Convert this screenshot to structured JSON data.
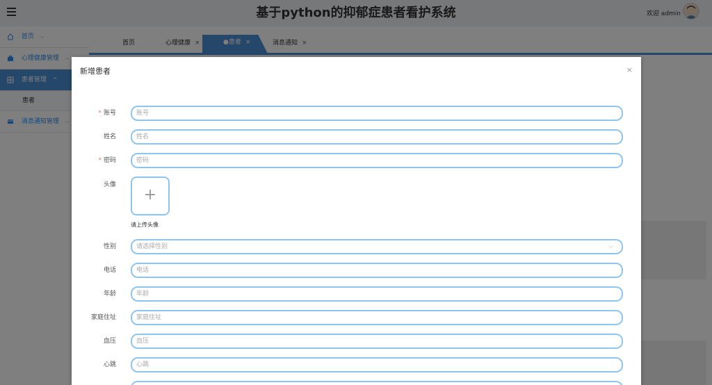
{
  "header": {
    "title": "基于python的抑郁症患者看护系统",
    "welcome": "欢迎 admin"
  },
  "sidebar": {
    "items": [
      {
        "label": "首页",
        "icon": "home-icon"
      },
      {
        "label": "心理健康管理",
        "icon": "briefcase-icon"
      },
      {
        "label": "患者管理",
        "icon": "grid-icon",
        "active": true
      },
      {
        "label": "消息通知管理",
        "icon": "card-icon"
      }
    ],
    "sub_items": [
      {
        "label": "患者"
      }
    ]
  },
  "tabs": [
    {
      "label": "首页",
      "closable": false
    },
    {
      "label": "心理健康",
      "closable": true
    },
    {
      "label": "●患者",
      "closable": true,
      "active": true
    },
    {
      "label": "消息通知",
      "closable": true
    }
  ],
  "dialog": {
    "title": "新增患者",
    "close": "×",
    "fields": [
      {
        "label": "账号",
        "required": true,
        "placeholder": "账号"
      },
      {
        "label": "姓名",
        "required": false,
        "placeholder": "姓名"
      },
      {
        "label": "密码",
        "required": true,
        "placeholder": "密码"
      },
      {
        "label": "性别",
        "required": false,
        "placeholder": "请选择性别",
        "type": "select"
      },
      {
        "label": "电话",
        "required": false,
        "placeholder": "电话"
      },
      {
        "label": "年龄",
        "required": false,
        "placeholder": "年龄"
      },
      {
        "label": "家庭住址",
        "required": false,
        "placeholder": "家庭住址"
      },
      {
        "label": "血压",
        "required": false,
        "placeholder": "血压"
      },
      {
        "label": "心跳",
        "required": false,
        "placeholder": "心跳"
      }
    ],
    "avatar_label": "头像",
    "upload_plus": "+",
    "upload_hint": "请上传头像"
  },
  "colors": {
    "accent": "#4a8fd2",
    "input_border": "#8ec5f0",
    "required": "#f56c6c"
  }
}
